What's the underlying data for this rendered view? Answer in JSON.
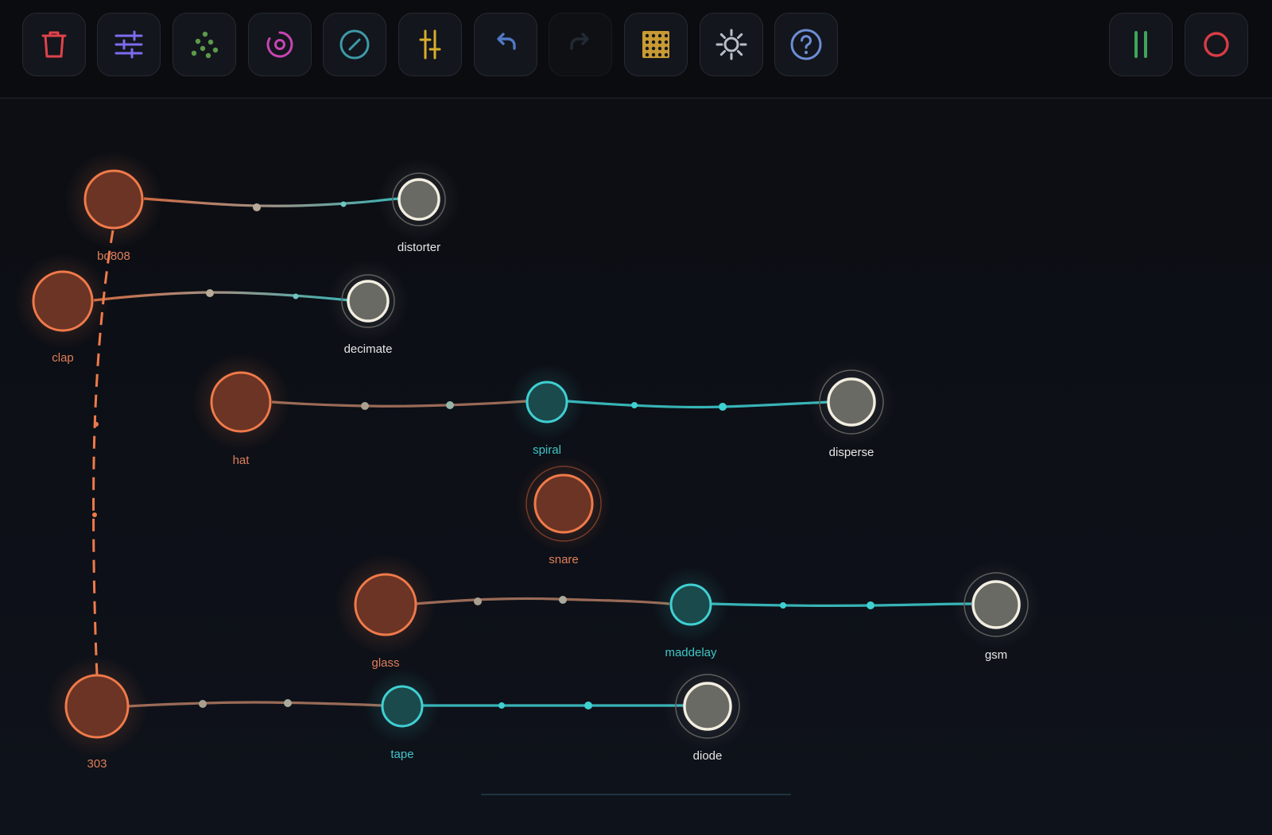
{
  "toolbar": {
    "left_buttons": [
      {
        "id": "delete",
        "icon": "trash-icon",
        "color": "#e0434b",
        "enabled": true
      },
      {
        "id": "mixer",
        "icon": "sliders-icon",
        "color": "#7d6cf0",
        "enabled": true
      },
      {
        "id": "scatter",
        "icon": "dots-icon",
        "color": "#5c9a4a",
        "enabled": true
      },
      {
        "id": "target",
        "icon": "target-icon",
        "color": "#c845b3",
        "enabled": true
      },
      {
        "id": "bypass",
        "icon": "slash-circle-icon",
        "color": "#3e9aa8",
        "enabled": true
      },
      {
        "id": "levels",
        "icon": "faders-icon",
        "color": "#d8ad2c",
        "enabled": true
      },
      {
        "id": "undo",
        "icon": "undo-icon",
        "color": "#4f79c4",
        "enabled": true
      },
      {
        "id": "redo",
        "icon": "redo-icon",
        "color": "#2a3240",
        "enabled": false
      },
      {
        "id": "grid",
        "icon": "grid-icon",
        "color": "#c99a33",
        "enabled": true
      },
      {
        "id": "settings",
        "icon": "gear-icon",
        "color": "#b8bec8",
        "enabled": true
      },
      {
        "id": "help",
        "icon": "help-icon",
        "color": "#6d8ed6",
        "enabled": true
      }
    ],
    "right_buttons": [
      {
        "id": "pause",
        "icon": "pause-icon",
        "color": "#3ea55a",
        "enabled": true
      },
      {
        "id": "record",
        "icon": "record-icon",
        "color": "#d83c45",
        "enabled": true
      }
    ]
  },
  "colors": {
    "source": "#f07a4a",
    "source_fill": "#6b3424",
    "effect": "#3fd0d2",
    "effect_fill": "#1b4a4c",
    "output_ring": "#f2eee0",
    "output_fill": "#6a6a65",
    "output_label": "#e6e6e6"
  },
  "nodes": [
    {
      "id": "bd808",
      "label": "bd808",
      "kind": "source"
    },
    {
      "id": "distorter",
      "label": "distorter",
      "kind": "output"
    },
    {
      "id": "clap",
      "label": "clap",
      "kind": "source"
    },
    {
      "id": "decimate",
      "label": "decimate",
      "kind": "output"
    },
    {
      "id": "hat",
      "label": "hat",
      "kind": "source"
    },
    {
      "id": "spiral",
      "label": "spiral",
      "kind": "effect"
    },
    {
      "id": "disperse",
      "label": "disperse",
      "kind": "output"
    },
    {
      "id": "snare",
      "label": "snare",
      "kind": "source-selected"
    },
    {
      "id": "glass",
      "label": "glass",
      "kind": "source"
    },
    {
      "id": "maddelay",
      "label": "maddelay",
      "kind": "effect"
    },
    {
      "id": "gsm",
      "label": "gsm",
      "kind": "output"
    },
    {
      "id": "303",
      "label": "303",
      "kind": "source"
    },
    {
      "id": "tape",
      "label": "tape",
      "kind": "effect"
    },
    {
      "id": "diode",
      "label": "diode",
      "kind": "output"
    }
  ],
  "links": [
    {
      "from": "bd808",
      "to": "distorter"
    },
    {
      "from": "clap",
      "to": "decimate"
    },
    {
      "from": "hat",
      "to": "spiral"
    },
    {
      "from": "spiral",
      "to": "disperse"
    },
    {
      "from": "glass",
      "to": "maddelay"
    },
    {
      "from": "maddelay",
      "to": "gsm"
    },
    {
      "from": "303",
      "to": "tape"
    },
    {
      "from": "tape",
      "to": "diode"
    },
    {
      "from": "bd808",
      "to": "303",
      "style": "dashed"
    }
  ]
}
